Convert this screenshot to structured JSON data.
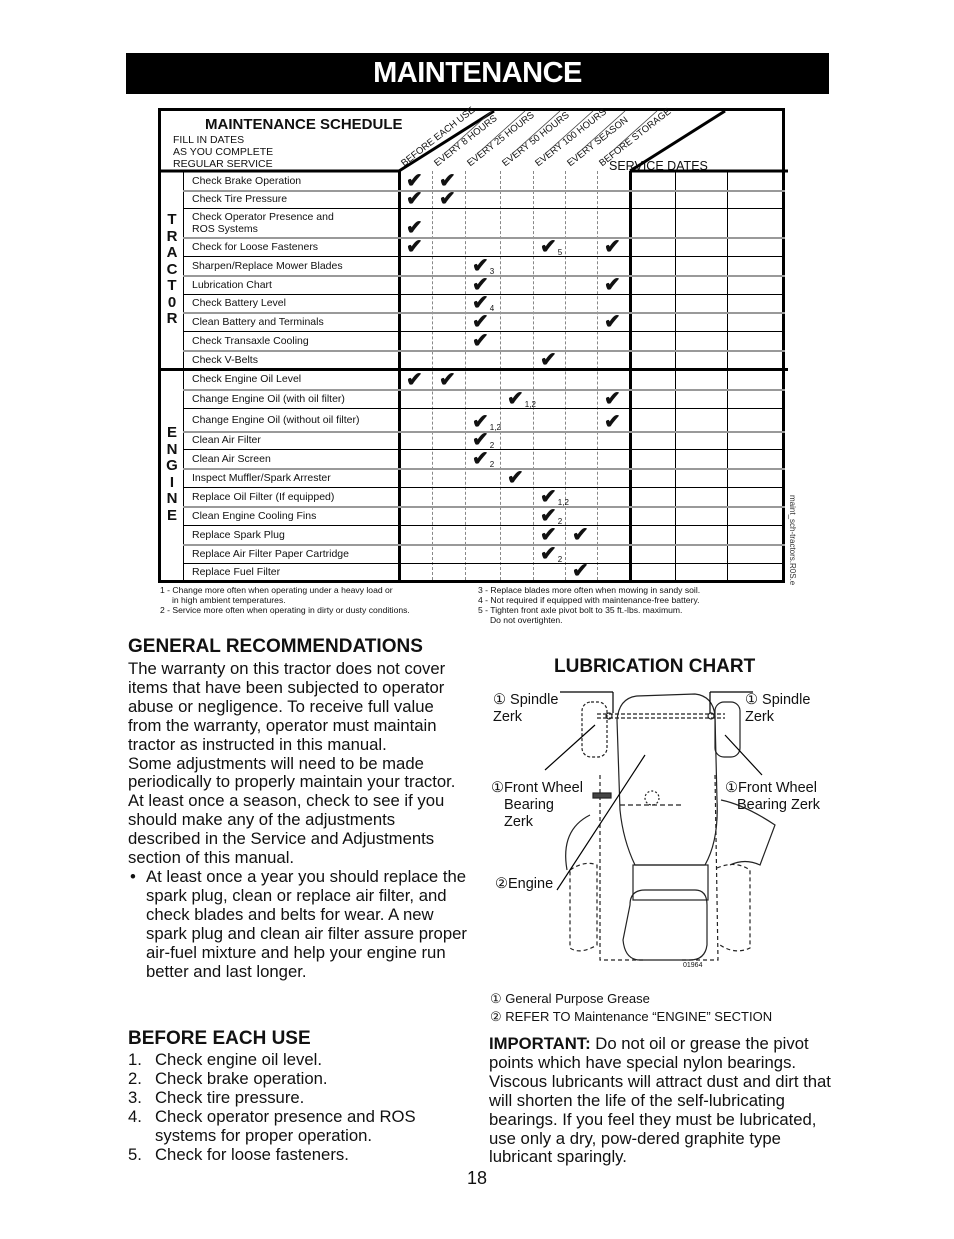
{
  "banner": {
    "title": "MAINTENANCE"
  },
  "schedule": {
    "title": "MAINTENANCE SCHEDULE",
    "subtitle_lines": [
      "FILL IN DATES",
      "AS YOU COMPLETE",
      "REGULAR SERVICE"
    ],
    "service_dates_label": "SERVICE DATES",
    "service_date_columns": 3,
    "columns": [
      "BEFORE EACH USE",
      "EVERY 8 HOURS",
      "EVERY 25 HOURS",
      "EVERY 50 HOURS",
      "EVERY 100 HOURS",
      "EVERY SEASON",
      "BEFORE STORAGE"
    ],
    "sections": [
      {
        "name": "TRACTOR",
        "letters": [
          "T",
          "R",
          "A",
          "C",
          "T",
          "0",
          "R"
        ],
        "rows": [
          {
            "label": "Check Brake Operation",
            "checks": [
              {
                "col": 0
              },
              {
                "col": 1
              }
            ]
          },
          {
            "label": "Check Tire Pressure",
            "checks": [
              {
                "col": 0
              },
              {
                "col": 1
              }
            ]
          },
          {
            "label": "Check Operator Presence and ROS Systems",
            "label_lines": [
              "Check Operator Presence and",
              "ROS Systems"
            ],
            "checks": [
              {
                "col": 0
              }
            ]
          },
          {
            "label": "Check for Loose Fasteners",
            "checks": [
              {
                "col": 0
              },
              {
                "col": 4,
                "note": "5"
              },
              {
                "col": 6
              }
            ]
          },
          {
            "label": "Sharpen/Replace Mower Blades",
            "checks": [
              {
                "col": 2,
                "note": "3"
              }
            ]
          },
          {
            "label": "Lubrication Chart",
            "checks": [
              {
                "col": 2
              },
              {
                "col": 6
              }
            ]
          },
          {
            "label": "Check Battery Level",
            "checks": [
              {
                "col": 2,
                "note": "4"
              }
            ]
          },
          {
            "label": "Clean Battery and Terminals",
            "checks": [
              {
                "col": 2
              },
              {
                "col": 6
              }
            ]
          },
          {
            "label": "Check Transaxle Cooling",
            "checks": [
              {
                "col": 2
              }
            ]
          },
          {
            "label": "Check V-Belts",
            "checks": [
              {
                "col": 4
              }
            ]
          }
        ]
      },
      {
        "name": "ENGINE",
        "letters": [
          "E",
          "N",
          "G",
          "I",
          "N",
          "E"
        ],
        "rows": [
          {
            "label": "Check Engine Oil Level",
            "checks": [
              {
                "col": 0
              },
              {
                "col": 1
              }
            ]
          },
          {
            "label": "Change Engine Oil (with oil filter)",
            "checks": [
              {
                "col": 3,
                "note": "1,2"
              },
              {
                "col": 6
              }
            ]
          },
          {
            "label": "Change Engine Oil (without oil filter)",
            "checks": [
              {
                "col": 2,
                "note": "1,2"
              },
              {
                "col": 6
              }
            ]
          },
          {
            "label": "Clean Air Filter",
            "checks": [
              {
                "col": 2,
                "note": "2"
              }
            ]
          },
          {
            "label": "Clean Air Screen",
            "checks": [
              {
                "col": 2,
                "note": "2"
              }
            ]
          },
          {
            "label": "Inspect Muffler/Spark Arrester",
            "checks": [
              {
                "col": 3
              }
            ]
          },
          {
            "label": "Replace Oil Filter (If equipped)",
            "checks": [
              {
                "col": 4,
                "note": "1,2"
              }
            ]
          },
          {
            "label": "Clean Engine Cooling Fins",
            "checks": [
              {
                "col": 4,
                "note": "2"
              }
            ]
          },
          {
            "label": "Replace Spark Plug",
            "checks": [
              {
                "col": 4
              },
              {
                "col": 5
              }
            ]
          },
          {
            "label": "Replace Air Filter Paper Cartridge",
            "checks": [
              {
                "col": 4,
                "note": "2"
              }
            ]
          },
          {
            "label": "Replace Fuel Filter",
            "checks": [
              {
                "col": 5
              }
            ]
          }
        ]
      }
    ],
    "footnotes_left": [
      "1 - Change more often when operating under a heavy load or\n     in high ambient temperatures.",
      "2 - Service more often when operating in dirty or dusty conditions."
    ],
    "footnotes_right": [
      "3 - Replace blades more often when mowing in sandy soil.",
      "4 - Not required if equipped with maintenance-free battery.",
      "5 - Tighten front axle pivot bolt to 35 ft.-lbs. maximum.\n     Do not overtighten."
    ],
    "side_code": "maint_sch-tractors.R0S.e",
    "check_glyph": "✔"
  },
  "general": {
    "heading": "GENERAL RECOMMENDATIONS",
    "paragraphs": [
      "The warranty on this tractor does not cover items that have been subjected to operator abuse or negligence.  To receive full value from the warranty, operator must maintain tractor as instructed in this manual.",
      "Some adjustments will need to be made periodically to properly maintain your tractor.",
      "At least once a season, check to see if you should make any of the adjustments described in the Service and Adjustments section of this manual."
    ],
    "bullet": "At least once a year you should replace the spark plug, clean or replace air filter, and check blades and belts for wear. A new spark plug and clean air filter assure proper air-fuel mixture and help your engine run better and last longer.",
    "bullet_symbol": "•"
  },
  "before_each_use": {
    "heading": "BEFORE EACH USE",
    "steps": [
      {
        "num": "1.",
        "text": "Check engine oil level."
      },
      {
        "num": "2.",
        "text": "Check brake operation."
      },
      {
        "num": "3.",
        "text": "Check tire pressure."
      },
      {
        "num": "4.",
        "text": "Check operator presence and ROS systems for proper operation."
      },
      {
        "num": "5.",
        "text": "Check for loose fasteners."
      }
    ]
  },
  "lubrication": {
    "heading": "LUBRICATION CHART",
    "labels": {
      "spindle_left": [
        "① Spindle",
        "Zerk"
      ],
      "spindle_right": [
        "① Spindle",
        "Zerk"
      ],
      "wheel_left": [
        "①Front Wheel",
        "Bearing",
        "Zerk"
      ],
      "wheel_right": [
        "①Front Wheel",
        "Bearing Zerk"
      ],
      "engine": "②Engine"
    },
    "figure_code": "01964",
    "legend": [
      {
        "mark": "①",
        "text": "General Purpose Grease"
      },
      {
        "mark": "②",
        "text": "REFER TO Maintenance  “ENGINE” SECTION"
      }
    ]
  },
  "important": {
    "label": "IMPORTANT:",
    "text": " Do not oil or grease the pivot points which have special nylon bearings.  Viscous lubricants will attract dust and dirt that will shorten the life of the self-lubricating bearings.  If you feel they must be lubricated, use only a dry, pow-dered graphite type lubricant sparingly."
  },
  "page_number": "18"
}
